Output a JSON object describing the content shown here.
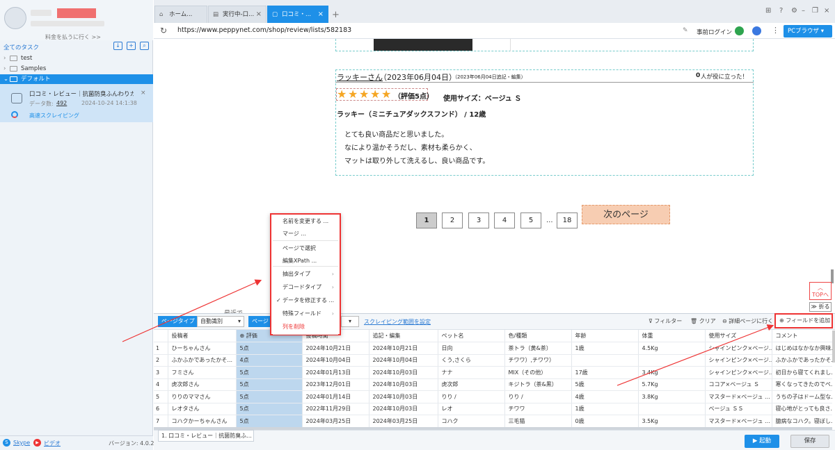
{
  "left_panel": {
    "upgrade_link": "料金を払うに行く >>",
    "all_tasks": "全てのタスク",
    "tree": [
      "test",
      "Samples",
      "デフォルト"
    ],
    "task": {
      "name": "口コミ・レビュー｜抗菌防臭ふんわりカド...",
      "count_label": "データ数:",
      "count": "492",
      "date": "2024-10-24 14:1:38",
      "mode": "高速スクレイピング"
    },
    "footer": {
      "skype": "Skype",
      "video": "ビデオ",
      "version": "バージョン: 4.0.2"
    }
  },
  "tabs": [
    {
      "label": "ホーム..."
    },
    {
      "label": "実行中-口..."
    },
    {
      "label": "口コミ・..."
    }
  ],
  "address": {
    "url": "https://www.peppynet.com/shop/review/lists/582183",
    "login": "事前ログイン",
    "browser": "PCブラウザ"
  },
  "review": {
    "name": "ラッキーさん",
    "date": "（2023年06月04日）",
    "edited": "（2023年06月04日追記・編集）",
    "helpful_count": "0",
    "helpful": "人が役に立った！",
    "stars": 5,
    "rating": "（評価5点）",
    "size": "使用サイズ：ベージュ Ｓ",
    "dog": "ラッキー（ミニチュアダックスフンド） / 12歳",
    "body": [
      "とても良い商品だと思いました。",
      "なにより温かそうだし、素材も柔らかく、",
      "マットは取り外して洗えるし、良い商品です。"
    ]
  },
  "pagination": {
    "pages": [
      "1",
      "2",
      "3",
      "4",
      "5"
    ],
    "ellipsis": "...",
    "last": "18",
    "next": "次のページ"
  },
  "side_buttons": {
    "top": "TOPへ",
    "fold": "折る"
  },
  "partial_text": "最近で",
  "toolbar": {
    "page_type_label": "ページタイプ",
    "page_type_value": "自動識別",
    "page_label2": "ページ",
    "scope_link": "スクレイピング範囲を設定",
    "filter": "フィルター",
    "clear": "クリア",
    "detail": "詳細ページに行く",
    "add_field": "フィールドを追加"
  },
  "context_menu": [
    "名前を変更する ...",
    "マージ ...",
    "ページで選択",
    "編集XPath ...",
    "抽出タイプ",
    "デコードタイプ",
    "データを修正する ...",
    "特殊フィールド",
    "列を削除"
  ],
  "table": {
    "headers": [
      "",
      "投稿者",
      "評価",
      "投稿時間",
      "追記・編集",
      "ペット名",
      "色/種類",
      "年齢",
      "体重",
      "使用サイズ",
      "コメント"
    ],
    "rows": [
      [
        "1",
        "ひーちゃんさん",
        "5点",
        "2024年10月21日",
        "2024年10月21日",
        "日向",
        "茶トラ（黄&茶）",
        "1歳",
        "4.5Kg",
        "シャインピンク×ベージ...",
        "はじめはなかなか興味..."
      ],
      [
        "2",
        "ふかふかであったかそ...",
        "4点",
        "2024年10月04日",
        "2024年10月04日",
        "くう,さくら",
        "チワワ）,チワワ）",
        "",
        "",
        "シャインピンク×ベージ...",
        "ふかふかであったかそ..."
      ],
      [
        "3",
        "フミさん",
        "5点",
        "2024年01月13日",
        "2024年10月03日",
        "ナナ",
        "MIX（その他）",
        "17歳",
        "3.4Kg",
        "シャインピンク×ベージ...",
        "初日から寝てくれまし..."
      ],
      [
        "4",
        "虎次郎さん",
        "5点",
        "2023年12月01日",
        "2024年10月03日",
        "虎次郎",
        "キジトラ（茶&黒）",
        "5歳",
        "5.7Kg",
        "ココア×ベージュ Ｓ",
        "寒くなってきたのでペ..."
      ],
      [
        "5",
        "りりのママさん",
        "5点",
        "2024年01月14日",
        "2024年10月03日",
        "りり /",
        "りり /",
        "4歳",
        "3.8Kg",
        "マスタード×ベージュ ...",
        "うちの子はドーム型な..."
      ],
      [
        "6",
        "レオタさん",
        "5点",
        "2022年11月29日",
        "2024年10月03日",
        "レオ",
        "チワワ",
        "1歳",
        "",
        "ベージュ ＳＳ",
        "寝心地がとっても良さ..."
      ],
      [
        "7",
        "コハクかーちゃんさん",
        "5点",
        "2024年03月25日",
        "2024年03月25日",
        "コハク",
        "三毛猫",
        "0歳",
        "3.5Kg",
        "マスタード×ベージュ ...",
        "臆病なコハク。寝ぼし..."
      ]
    ]
  },
  "bottom": {
    "task_tab": "1. 口コミ・レビュー｜抗菌防臭ふ...",
    "start": "起動",
    "save": "保存"
  },
  "colors": {
    "accent": "#1e90e8",
    "highlight": "#e33",
    "selected_col": "#bdd7ee",
    "next_btn": "#f7cdb2"
  }
}
